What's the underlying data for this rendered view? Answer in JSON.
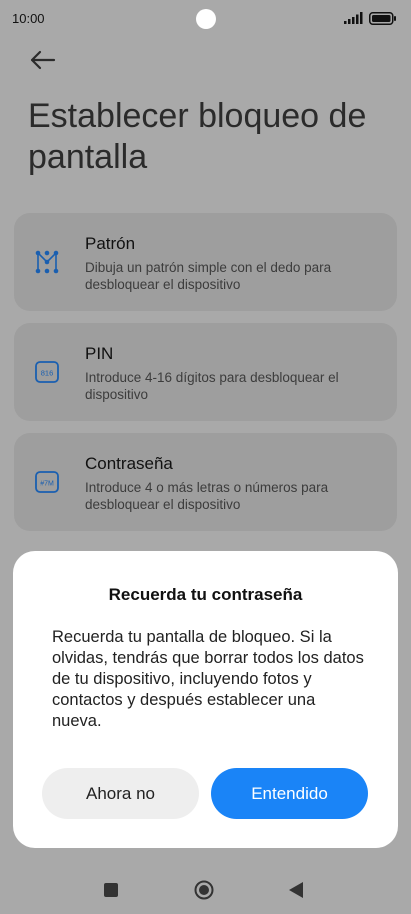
{
  "status_bar": {
    "time": "10:00"
  },
  "page": {
    "title": "Establecer bloqueo de pantalla"
  },
  "options": [
    {
      "title": "Patrón",
      "description": "Dibuja un patrón simple con el dedo para desbloquear el dispositivo",
      "icon": "pattern-icon"
    },
    {
      "title": "PIN",
      "description": "Introduce 4-16 dígitos para desbloquear el dispositivo",
      "icon": "pin-icon",
      "icon_text": "816"
    },
    {
      "title": "Contraseña",
      "description": "Introduce 4 o más letras o números para desbloquear el dispositivo",
      "icon": "password-icon",
      "icon_text": "#7M"
    }
  ],
  "dialog": {
    "title": "Recuerda tu contraseña",
    "message": "Recuerda tu pantalla de bloqueo. Si la olvidas, tendrás que borrar todos los datos de tu dispositivo, incluyendo fotos y contactos y después establecer una nueva.",
    "cancel_label": "Ahora no",
    "confirm_label": "Entendido"
  },
  "colors": {
    "accent": "#1a84f7",
    "overlay_bg": "#a9a9a9",
    "card_bg": "#9e9e9e"
  }
}
